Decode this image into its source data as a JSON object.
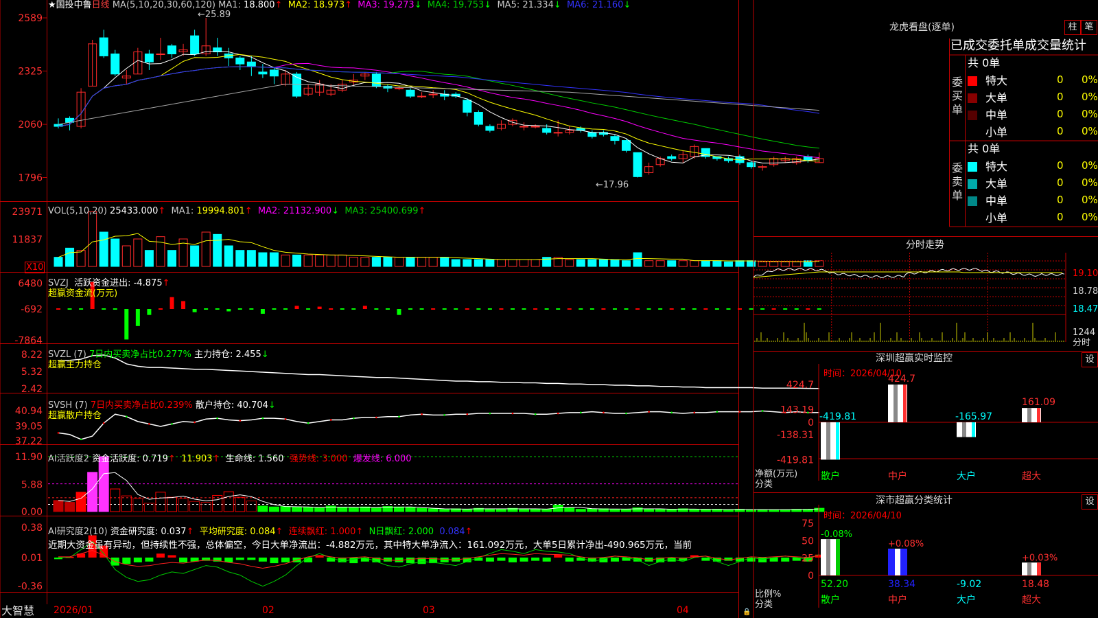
{
  "colors": {
    "up": "#ff2a2a",
    "down": "#00ffff",
    "ma1": "#ffffff",
    "ma2": "#ffff00",
    "ma3": "#ff00ff",
    "ma4": "#00cc00",
    "ma5": "#3333ff",
    "grid": "#c00000",
    "flow_pos": "#ff0000",
    "flow_neg": "#00ff00",
    "text_gray": "#c8c8c8"
  },
  "chart_data": [
    {
      "type": "candlestick",
      "title": "国投中鲁",
      "period": "日线",
      "indicator": "MA(5,10,20,30,60,120)",
      "y_ticks": [
        "2589",
        "2325",
        "2060",
        "1796"
      ],
      "ylim": [
        17.5,
        26.3
      ],
      "x_ticks": [
        "2026/01",
        "02",
        "03",
        "04"
      ],
      "annotations": [
        "25.89",
        "17.96"
      ],
      "ma_values": {
        "MA1": "18.800",
        "MA2": "18.973",
        "MA3": "19.273",
        "MA4": "19.753",
        "MA5": "21.334",
        "MA6": "21.160"
      },
      "candles": [
        {
          "o": 20.6,
          "c": 20.5,
          "h": 20.9,
          "l": 20.4
        },
        {
          "o": 20.9,
          "c": 20.7,
          "h": 21.0,
          "l": 20.3
        },
        {
          "o": 20.5,
          "c": 22.2,
          "h": 22.4,
          "l": 20.4
        },
        {
          "o": 22.5,
          "c": 24.6,
          "h": 24.8,
          "l": 22.5
        },
        {
          "o": 24.9,
          "c": 24.0,
          "h": 25.3,
          "l": 23.9
        },
        {
          "o": 24.1,
          "c": 23.1,
          "h": 24.3,
          "l": 23.0
        },
        {
          "o": 22.9,
          "c": 23.0,
          "h": 23.3,
          "l": 22.6
        },
        {
          "o": 23.1,
          "c": 24.2,
          "h": 24.4,
          "l": 23.1
        },
        {
          "o": 24.1,
          "c": 23.7,
          "h": 24.3,
          "l": 23.3
        },
        {
          "o": 24.1,
          "c": 24.1,
          "h": 24.9,
          "l": 23.8
        },
        {
          "o": 24.5,
          "c": 24.1,
          "h": 24.6,
          "l": 23.9
        },
        {
          "o": 24.2,
          "c": 24.3,
          "h": 24.6,
          "l": 24.0
        },
        {
          "o": 25.0,
          "c": 24.1,
          "h": 25.3,
          "l": 24.0
        },
        {
          "o": 24.1,
          "c": 24.5,
          "h": 25.89,
          "l": 24.0
        },
        {
          "o": 24.4,
          "c": 24.2,
          "h": 24.9,
          "l": 24.0
        },
        {
          "o": 24.1,
          "c": 23.9,
          "h": 24.4,
          "l": 23.5
        },
        {
          "o": 23.9,
          "c": 23.6,
          "h": 24.0,
          "l": 23.3
        },
        {
          "o": 23.7,
          "c": 23.5,
          "h": 24.0,
          "l": 23.0
        },
        {
          "o": 23.2,
          "c": 23.1,
          "h": 23.6,
          "l": 22.9
        },
        {
          "o": 23.3,
          "c": 23.0,
          "h": 23.4,
          "l": 22.6
        },
        {
          "o": 22.6,
          "c": 23.1,
          "h": 23.3,
          "l": 22.5
        },
        {
          "o": 23.1,
          "c": 22.0,
          "h": 23.2,
          "l": 21.9
        },
        {
          "o": 22.1,
          "c": 22.4,
          "h": 22.6,
          "l": 22.0
        },
        {
          "o": 22.2,
          "c": 22.6,
          "h": 22.8,
          "l": 22.0
        },
        {
          "o": 22.1,
          "c": 22.3,
          "h": 22.6,
          "l": 22.0
        },
        {
          "o": 22.3,
          "c": 22.6,
          "h": 22.8,
          "l": 22.2
        },
        {
          "o": 22.7,
          "c": 22.8,
          "h": 23.1,
          "l": 22.5
        },
        {
          "o": 23.0,
          "c": 23.1,
          "h": 23.2,
          "l": 22.8
        },
        {
          "o": 23.1,
          "c": 22.5,
          "h": 23.2,
          "l": 22.4
        },
        {
          "o": 22.5,
          "c": 22.4,
          "h": 22.6,
          "l": 22.2
        },
        {
          "o": 22.4,
          "c": 22.4,
          "h": 22.5,
          "l": 22.3
        },
        {
          "o": 22.3,
          "c": 22.0,
          "h": 22.4,
          "l": 21.9
        },
        {
          "o": 22.0,
          "c": 22.0,
          "h": 22.2,
          "l": 21.9
        },
        {
          "o": 22.1,
          "c": 22.1,
          "h": 22.3,
          "l": 21.9
        },
        {
          "o": 22.1,
          "c": 22.0,
          "h": 22.3,
          "l": 21.8
        },
        {
          "o": 22.1,
          "c": 22.0,
          "h": 22.2,
          "l": 21.9
        },
        {
          "o": 21.8,
          "c": 21.2,
          "h": 21.9,
          "l": 21.0
        },
        {
          "o": 21.2,
          "c": 20.6,
          "h": 21.3,
          "l": 20.5
        },
        {
          "o": 20.5,
          "c": 20.3,
          "h": 20.6,
          "l": 20.2
        },
        {
          "o": 20.4,
          "c": 20.6,
          "h": 20.8,
          "l": 20.3
        },
        {
          "o": 20.6,
          "c": 20.8,
          "h": 20.9,
          "l": 20.5
        },
        {
          "o": 20.5,
          "c": 20.5,
          "h": 20.7,
          "l": 20.3
        },
        {
          "o": 20.5,
          "c": 20.5,
          "h": 20.6,
          "l": 20.4
        },
        {
          "o": 20.4,
          "c": 20.2,
          "h": 20.6,
          "l": 20.1
        },
        {
          "o": 20.2,
          "c": 20.2,
          "h": 20.8,
          "l": 20.0
        },
        {
          "o": 20.2,
          "c": 20.3,
          "h": 20.5,
          "l": 20.1
        },
        {
          "o": 20.4,
          "c": 20.3,
          "h": 20.5,
          "l": 20.2
        },
        {
          "o": 20.2,
          "c": 20.0,
          "h": 20.3,
          "l": 19.9
        },
        {
          "o": 20.2,
          "c": 20.1,
          "h": 20.3,
          "l": 20.0
        },
        {
          "o": 20.0,
          "c": 19.8,
          "h": 20.1,
          "l": 19.6
        },
        {
          "o": 19.8,
          "c": 19.3,
          "h": 19.9,
          "l": 19.2
        },
        {
          "o": 19.2,
          "c": 18.0,
          "h": 19.2,
          "l": 17.96
        },
        {
          "o": 18.2,
          "c": 18.5,
          "h": 18.7,
          "l": 18.1
        },
        {
          "o": 18.6,
          "c": 18.9,
          "h": 19.0,
          "l": 18.5
        },
        {
          "o": 19.0,
          "c": 18.9,
          "h": 19.1,
          "l": 18.8
        },
        {
          "o": 18.9,
          "c": 19.1,
          "h": 19.3,
          "l": 18.7
        },
        {
          "o": 19.0,
          "c": 19.5,
          "h": 19.6,
          "l": 18.9
        },
        {
          "o": 19.4,
          "c": 19.0,
          "h": 19.4,
          "l": 18.9
        },
        {
          "o": 19.0,
          "c": 18.9,
          "h": 19.0,
          "l": 18.8
        },
        {
          "o": 18.9,
          "c": 18.8,
          "h": 19.0,
          "l": 18.7
        },
        {
          "o": 19.0,
          "c": 18.7,
          "h": 19.1,
          "l": 18.6
        },
        {
          "o": 18.7,
          "c": 18.5,
          "h": 18.8,
          "l": 18.4
        },
        {
          "o": 18.5,
          "c": 18.5,
          "h": 18.6,
          "l": 18.3
        },
        {
          "o": 18.6,
          "c": 18.9,
          "h": 19.0,
          "l": 18.5
        },
        {
          "o": 18.8,
          "c": 18.9,
          "h": 19.0,
          "l": 18.7
        },
        {
          "o": 18.7,
          "c": 18.9,
          "h": 19.0,
          "l": 18.6
        },
        {
          "o": 19.0,
          "c": 18.8,
          "h": 19.1,
          "l": 18.7
        },
        {
          "o": 18.7,
          "c": 18.9,
          "h": 19.2,
          "l": 18.7
        }
      ]
    },
    {
      "type": "bar",
      "title": "VOL(5,10,20)",
      "y_ticks": [
        "23971",
        "11837",
        "X10"
      ],
      "ylim": [
        0,
        24000
      ],
      "values": {
        "VOL": "25433.000",
        "MA1": "19994.801",
        "MA2": "21132.900",
        "MA3": "25400.699"
      },
      "volumes": [
        4000,
        8000,
        7000,
        24000,
        15000,
        12000,
        9000,
        12000,
        7000,
        13000,
        7000,
        12000,
        9000,
        15000,
        14000,
        9000,
        7000,
        7000,
        6000,
        6000,
        5000,
        5000,
        5000,
        5000,
        5000,
        5000,
        4000,
        4000,
        4000,
        4000,
        4000,
        4000,
        4000,
        4000,
        4000,
        3000,
        3000,
        3000,
        3000,
        3000,
        3000,
        3000,
        3000,
        4000,
        4000,
        3000,
        3000,
        3000,
        3000,
        3000,
        2500,
        6000,
        2500,
        2500,
        2500,
        2500,
        2500,
        2500,
        2500,
        2000,
        2500,
        2500,
        2000,
        2000,
        2000,
        2000,
        2500,
        2500
      ]
    },
    {
      "type": "bar",
      "title": "SVZJ",
      "legend": "活跃资金进出",
      "subtitle": "超赢资金流(万元)",
      "y_ticks": [
        "6480",
        "-692",
        "-7864"
      ],
      "current": "-4.875",
      "values": [
        0,
        0,
        0,
        6800,
        0,
        0,
        -7700,
        -4300,
        -1500,
        0,
        3000,
        2000,
        -800,
        0,
        0,
        -600,
        0,
        0,
        -1200,
        0,
        0,
        800,
        0,
        600,
        0,
        0,
        0,
        800,
        0,
        0,
        -1500,
        0,
        0,
        0,
        0,
        0,
        0,
        0,
        0,
        0,
        0,
        0,
        0,
        0,
        0,
        0,
        0,
        0,
        0,
        0,
        0,
        0,
        0,
        0,
        0,
        0,
        0,
        0,
        0,
        0,
        0,
        0,
        0,
        0,
        0,
        0,
        0,
        0
      ]
    },
    {
      "type": "line",
      "title": "SVZL (7)",
      "legend": "7日内买卖净占比0.277%",
      "series_name": "主力持仓",
      "current": "2.455",
      "subtitle": "超赢主力持仓",
      "y_ticks": [
        "8.22",
        "5.32",
        "2.42"
      ],
      "values": [
        7.2,
        7.2,
        7.4,
        8.0,
        8.1,
        7.6,
        6.6,
        6.2,
        6.0,
        6.0,
        5.9,
        5.8,
        5.7,
        5.7,
        5.6,
        5.5,
        5.4,
        5.3,
        5.2,
        5.1,
        5.0,
        4.9,
        4.8,
        4.8,
        4.7,
        4.6,
        4.5,
        4.4,
        4.3,
        4.3,
        4.2,
        4.1,
        4.0,
        3.9,
        3.8,
        3.7,
        3.7,
        3.6,
        3.6,
        3.5,
        3.5,
        3.4,
        3.4,
        3.3,
        3.3,
        3.2,
        3.2,
        3.1,
        3.1,
        3.0,
        3.0,
        2.9,
        2.9,
        2.8,
        2.8,
        2.7,
        2.7,
        2.6,
        2.6,
        2.6,
        2.6,
        2.6,
        2.5,
        2.5,
        2.5,
        2.5,
        2.46,
        2.455
      ]
    },
    {
      "type": "line",
      "title": "SVSH (7)",
      "legend": "7日内买卖净占比0.239%",
      "series_name": "散户持仓",
      "current": "40.704",
      "subtitle": "超赢散户持仓",
      "y_ticks": [
        "40.94",
        "39.05",
        "37.22"
      ],
      "values": [
        38.2,
        38.0,
        37.4,
        37.8,
        39.4,
        40.5,
        40.2,
        39.6,
        39.3,
        39.0,
        39.3,
        39.6,
        39.5,
        39.9,
        40.0,
        39.8,
        39.7,
        39.8,
        40.0,
        40.0,
        39.9,
        39.6,
        39.4,
        39.6,
        39.8,
        39.8,
        40.0,
        40.1,
        40.1,
        40.2,
        40.2,
        40.4,
        40.5,
        40.4,
        40.4,
        40.5,
        40.5,
        40.6,
        40.6,
        40.6,
        40.6,
        40.6,
        40.5,
        40.5,
        40.6,
        40.7,
        40.7,
        40.8,
        40.7,
        40.6,
        40.6,
        40.7,
        40.8,
        40.8,
        40.7,
        40.6,
        40.7,
        40.7,
        40.8,
        40.8,
        40.8,
        40.8,
        40.9,
        40.8,
        40.7,
        40.8,
        40.7,
        40.704
      ]
    },
    {
      "type": "bar",
      "title": "AI活跃度2",
      "legend": "资金活跃度",
      "current": "0.719",
      "v2": "11.903",
      "life_label": "生命线",
      "life": "1.560",
      "strong_label": "强势线",
      "strong": "3.000",
      "burst_label": "爆发线",
      "burst": "6.000",
      "y_ticks": [
        "11.90",
        "5.88",
        "0.00"
      ],
      "values": [
        2.4,
        2.0,
        4.2,
        8.5,
        11.9,
        4.9,
        3.4,
        2.8,
        1.8,
        4.2,
        3.1,
        2.8,
        2.2,
        2.0,
        3.5,
        4.3,
        3.1,
        2.3,
        1.2,
        1.0,
        1.1,
        1.0,
        0.9,
        0.8,
        1.2,
        0.9,
        0.8,
        1.0,
        0.8,
        1.1,
        1.0,
        0.9,
        0.7,
        0.6,
        0.5,
        0.6,
        0.5,
        0.7,
        0.6,
        0.5,
        0.7,
        0.6,
        0.5,
        0.5,
        1.4,
        0.8,
        0.5,
        0.6,
        0.6,
        0.5,
        0.5,
        0.8,
        0.5,
        0.5,
        0.5,
        0.6,
        0.5,
        0.4,
        0.5,
        0.4,
        0.5,
        0.4,
        0.4,
        0.4,
        0.4,
        0.5,
        0.5,
        0.719
      ]
    },
    {
      "type": "bar",
      "title": "AI研究度2(10)",
      "legend": "资金研究度",
      "current": "0.037",
      "avg_label": "平均研究度",
      "avg": "0.084",
      "s1_label": "连续飘红",
      "s1": "1.000",
      "s2_label": "N日飘红",
      "s2": "2.000",
      "s3": "0.084",
      "text": "近期大资金虽有异动，但持续性不强，总体偏空，今日大单净流出：-4.882万元，其中特大单净流入：161.092万元，大单5日累计净出-490.965万元，当前",
      "y_ticks": [
        "0.38",
        "0.01",
        "-0.36"
      ],
      "values": [
        -0.02,
        0.01,
        0.05,
        0.28,
        0.15,
        -0.1,
        -0.08,
        -0.06,
        -0.05,
        0.05,
        0.03,
        -0.06,
        -0.05,
        -0.04,
        -0.05,
        -0.06,
        -0.03,
        -0.03,
        -0.05,
        -0.07,
        -0.06,
        -0.06,
        -0.06,
        0.02,
        -0.05,
        -0.06,
        -0.07,
        -0.05,
        -0.06,
        -0.05,
        -0.06,
        -0.07,
        -0.08,
        -0.07,
        -0.06,
        -0.05,
        -0.06,
        -0.04,
        -0.05,
        -0.04,
        -0.06,
        -0.05,
        -0.04,
        -0.05,
        0.04,
        -0.05,
        -0.04,
        -0.05,
        -0.06,
        -0.05,
        -0.04,
        -0.05,
        -0.05,
        -0.06,
        -0.05,
        -0.04,
        0.03,
        -0.04,
        -0.05,
        -0.04,
        -0.05,
        -0.05,
        -0.06,
        -0.05,
        -0.05,
        -0.04,
        -0.05,
        0.037
      ]
    }
  ],
  "right": {
    "dragon": {
      "title": "龙虎看盘(逐单)",
      "tab1": "柱",
      "tab2": "笔",
      "header": "已成交委托单成交量统计",
      "buy": {
        "label": "委买单",
        "total": "共 0单",
        "rows": [
          {
            "label": "特大",
            "v": "0",
            "p": "0%",
            "color": "#ff0000"
          },
          {
            "label": "大单",
            "v": "0",
            "p": "0%",
            "color": "#880000"
          },
          {
            "label": "中单",
            "v": "0",
            "p": "0%",
            "color": "#550000"
          },
          {
            "label": "小单",
            "v": "0",
            "p": "0%",
            "color": ""
          }
        ]
      },
      "sell": {
        "label": "委卖单",
        "total": "共 0单",
        "rows": [
          {
            "label": "特大",
            "v": "0",
            "p": "0%",
            "color": "#00ffff"
          },
          {
            "label": "大单",
            "v": "0",
            "p": "0%",
            "color": "#00aaaa"
          },
          {
            "label": "中单",
            "v": "0",
            "p": "0%",
            "color": "#008888"
          },
          {
            "label": "小单",
            "v": "0",
            "p": "0%",
            "color": ""
          }
        ]
      }
    },
    "intraday": {
      "title": "分时走势",
      "y_ticks": [
        "19.10",
        "18.78",
        "18.47"
      ],
      "vol_tick": "1244",
      "vol_label": "分时"
    },
    "monitor": {
      "title": "深圳超赢实时监控",
      "btn": "设",
      "time_label": "时间：",
      "time": "2026/04/10",
      "y_ticks": [
        "424.7",
        "143.19",
        "0",
        "-138.31",
        "-419.81"
      ],
      "left_label1": "净额(万元)",
      "left_label2": "分类",
      "categories": [
        "散户",
        "中户",
        "大户",
        "超大"
      ],
      "values": [
        -419.81,
        424.7,
        -165.97,
        161.09
      ],
      "value_labels": [
        "-419.81",
        "424.7",
        "-165.97",
        "161.09"
      ]
    },
    "stats": {
      "title": "深市超赢分类统计",
      "btn": "设",
      "time_label": "时间：",
      "time": "2026/04/10",
      "y_ticks": [
        "75",
        "50",
        "25",
        "0"
      ],
      "left_label1": "比例%",
      "left_label2": "分类",
      "categories": [
        "散户",
        "中户",
        "大户",
        "超大"
      ],
      "values": [
        52.2,
        38.34,
        -9.02,
        18.48
      ],
      "value_labels": [
        "52.20",
        "38.34",
        "-9.02",
        "18.48"
      ],
      "top_labels": [
        "-0.08%",
        "+0.08%",
        "",
        "+0.03%"
      ]
    }
  },
  "footer": {
    "brand": "大智慧"
  }
}
